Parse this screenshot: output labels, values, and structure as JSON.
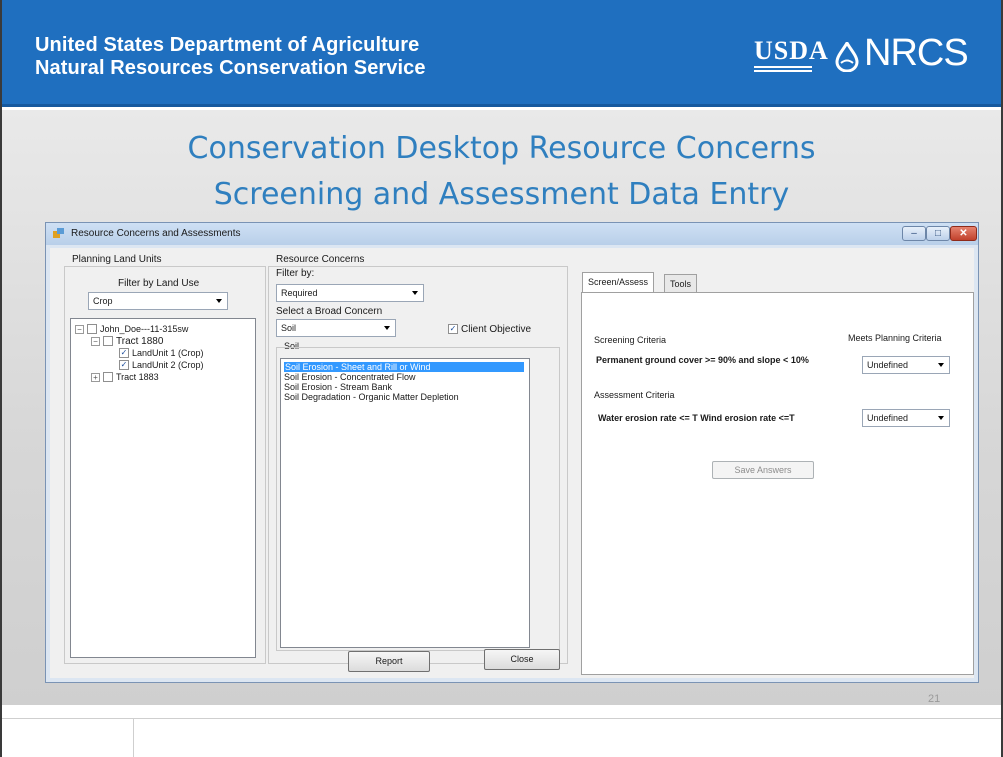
{
  "banner": {
    "line1": "United States Department of Agriculture",
    "line2": "Natural Resources Conservation Service",
    "usda_logo": "USDA",
    "nrcs_logo": "NRCS"
  },
  "slide": {
    "title_line1": "Conservation Desktop Resource Concerns",
    "title_line2": "Screening and Assessment Data Entry",
    "page_number": "21"
  },
  "window": {
    "title": "Resource Concerns and Assessments",
    "controls": {
      "minimize": "–",
      "maximize": "□",
      "close": "✕"
    }
  },
  "planning": {
    "group_label": "Planning Land Units",
    "filter_label": "Filter by Land Use",
    "filter_value": "Crop",
    "tree": [
      {
        "label": "John_Doe---11-315sw",
        "expander": "−",
        "checked": false
      },
      {
        "label": "Tract 1880",
        "expander": "−",
        "checked": false
      },
      {
        "label": "LandUnit 1 (Crop)",
        "checked": true
      },
      {
        "label": "LandUnit 2 (Crop)",
        "checked": true
      },
      {
        "label": "Tract 1883",
        "expander": "+",
        "checked": false
      }
    ]
  },
  "concerns": {
    "group_label": "Resource Concerns",
    "filter_label": "Filter by:",
    "filter_value": "Required",
    "broad_label": "Select a Broad Concern",
    "broad_value": "Soil",
    "client_objective_label": "Client Objective",
    "client_objective_checked": true,
    "list_group_label": "Soil",
    "items": [
      "Soil Erosion - Sheet and Rill or Wind",
      "Soil Erosion - Concentrated Flow",
      "Soil Erosion - Stream Bank",
      "Soil Degradation - Organic Matter Depletion"
    ],
    "selected_index": 0
  },
  "tabs": {
    "active": "Screen/Assess",
    "inactive": "Tools"
  },
  "screen": {
    "screening_header": "Screening Criteria",
    "meets_header": "Meets Planning Criteria",
    "screening_question": "Permanent ground cover >= 90% and slope < 10%",
    "screening_answer": "Undefined",
    "assessment_header": "Assessment Criteria",
    "assessment_question": "Water erosion rate <= T  Wind erosion rate <=T",
    "assessment_answer": "Undefined",
    "save_button": "Save Answers"
  },
  "bottom_buttons": {
    "report": "Report",
    "close": "Close"
  },
  "colors": {
    "banner_blue": "#1f6fbf",
    "title_blue": "#2f7fbf",
    "selection_blue": "#3399ff"
  }
}
